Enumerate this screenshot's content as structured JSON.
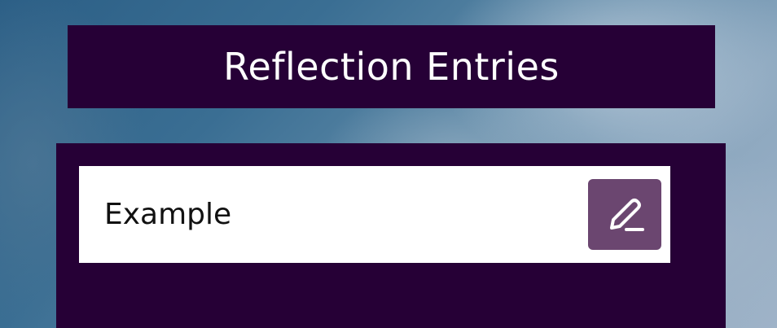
{
  "header": {
    "title": "Reflection Entries"
  },
  "entries": [
    {
      "label": "Example",
      "action_icon": "pencil-edit-icon"
    }
  ],
  "colors": {
    "panel_bg": "#260036",
    "edit_button_bg": "#6b4670",
    "entry_bg": "#ffffff",
    "title_text": "#ffffff"
  }
}
